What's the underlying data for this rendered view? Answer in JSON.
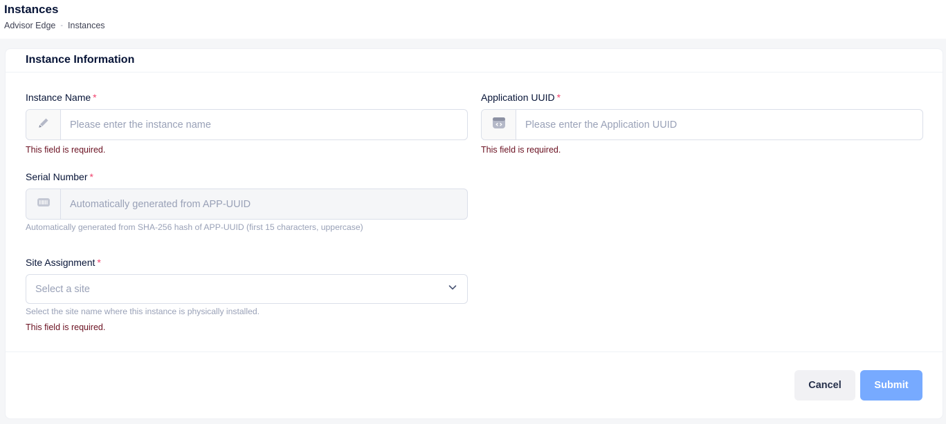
{
  "header": {
    "title": "Instances",
    "breadcrumb": [
      "Advisor Edge",
      "Instances"
    ],
    "breadcrumb_sep": "-"
  },
  "card": {
    "title": "Instance Information"
  },
  "form": {
    "required_mark": "*",
    "instance_name": {
      "label": "Instance Name",
      "placeholder": "Please enter the instance name",
      "value": "",
      "icon": "pencil-icon",
      "error": "This field is required."
    },
    "application_uuid": {
      "label": "Application UUID",
      "placeholder": "Please enter the Application UUID",
      "value": "",
      "icon": "code-window-icon",
      "error": "This field is required."
    },
    "serial_number": {
      "label": "Serial Number",
      "placeholder": "Automatically generated from APP-UUID",
      "value": "",
      "icon": "barcode-icon",
      "hint": "Automatically generated from SHA-256 hash of APP-UUID (first 15 characters, uppercase)"
    },
    "site_assignment": {
      "label": "Site Assignment",
      "selected": "Select a site",
      "icon": "chevron-down-icon",
      "hint": "Select the site name where this instance is physically installed.",
      "error": "This field is required."
    }
  },
  "footer": {
    "cancel_label": "Cancel",
    "submit_label": "Submit"
  },
  "colors": {
    "required": "#f1416c",
    "error_text": "#6a1020",
    "submit_bg": "#77aaff",
    "cancel_bg": "#f1f1f4"
  }
}
